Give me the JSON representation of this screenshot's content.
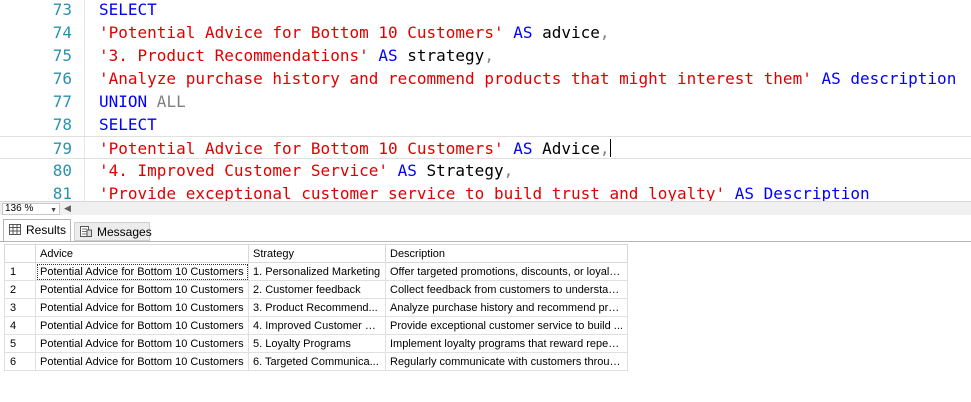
{
  "editor": {
    "lines": [
      {
        "no": "73",
        "tokens": [
          {
            "t": "SELECT",
            "c": "kw"
          }
        ]
      },
      {
        "no": "74",
        "tokens": [
          {
            "t": "'Potential Advice for Bottom 10 Customers'",
            "c": "str"
          },
          {
            "t": " AS ",
            "c": "kw"
          },
          {
            "t": "advice",
            "c": "plain"
          },
          {
            "t": ",",
            "c": "gray"
          }
        ]
      },
      {
        "no": "75",
        "tokens": [
          {
            "t": "'3. Product Recommendations'",
            "c": "str"
          },
          {
            "t": " AS ",
            "c": "kw"
          },
          {
            "t": "strategy",
            "c": "plain"
          },
          {
            "t": ",",
            "c": "gray"
          }
        ]
      },
      {
        "no": "76",
        "tokens": [
          {
            "t": "'Analyze purchase history and recommend products that might interest them'",
            "c": "str"
          },
          {
            "t": " AS description",
            "c": "kw"
          }
        ]
      },
      {
        "no": "77",
        "tokens": [
          {
            "t": "UNION",
            "c": "kw"
          },
          {
            "t": " ALL",
            "c": "gray"
          }
        ]
      },
      {
        "no": "78",
        "tokens": [
          {
            "t": "SELECT",
            "c": "kw"
          }
        ]
      },
      {
        "no": "79",
        "tokens": [
          {
            "t": "'Potential Advice for Bottom 10 Customers'",
            "c": "str"
          },
          {
            "t": " AS ",
            "c": "kw"
          },
          {
            "t": "Advice",
            "c": "plain"
          },
          {
            "t": ",",
            "c": "gray"
          }
        ],
        "current": true
      },
      {
        "no": "80",
        "tokens": [
          {
            "t": "'4. Improved Customer Service'",
            "c": "str"
          },
          {
            "t": " AS ",
            "c": "kw"
          },
          {
            "t": "Strategy",
            "c": "plain"
          },
          {
            "t": ",",
            "c": "gray"
          }
        ]
      },
      {
        "no": "81",
        "tokens": [
          {
            "t": "'Provide exceptional customer service to build trust and loyalty'",
            "c": "str"
          },
          {
            "t": " AS Description",
            "c": "kw"
          }
        ]
      }
    ]
  },
  "zoom": {
    "value": "136 %"
  },
  "tabs": {
    "results": "Results",
    "messages": "Messages"
  },
  "grid": {
    "headers": [
      "",
      "Advice",
      "Strategy",
      "Description"
    ],
    "rows": [
      [
        "1",
        "Potential Advice for Bottom 10 Customers",
        "1. Personalized Marketing",
        "Offer targeted promotions, discounts, or loyalty..."
      ],
      [
        "2",
        "Potential Advice for Bottom 10 Customers",
        "2. Customer feedback",
        "Collect feedback from customers to understan..."
      ],
      [
        "3",
        "Potential Advice for Bottom 10 Customers",
        "3. Product Recommend...",
        "Analyze purchase history and recommend pro..."
      ],
      [
        "4",
        "Potential Advice for Bottom 10 Customers",
        "4. Improved Customer S...",
        "Provide exceptional customer service to build ..."
      ],
      [
        "5",
        "Potential Advice for Bottom 10 Customers",
        "5. Loyalty Programs",
        "Implement loyalty programs that reward repeat ..."
      ],
      [
        "6",
        "Potential Advice for Bottom 10 Customers",
        "6. Targeted Communica...",
        "Regularly communicate with customers throug..."
      ]
    ]
  },
  "icons": {
    "results": "grid-icon",
    "messages": "messages-icon"
  }
}
